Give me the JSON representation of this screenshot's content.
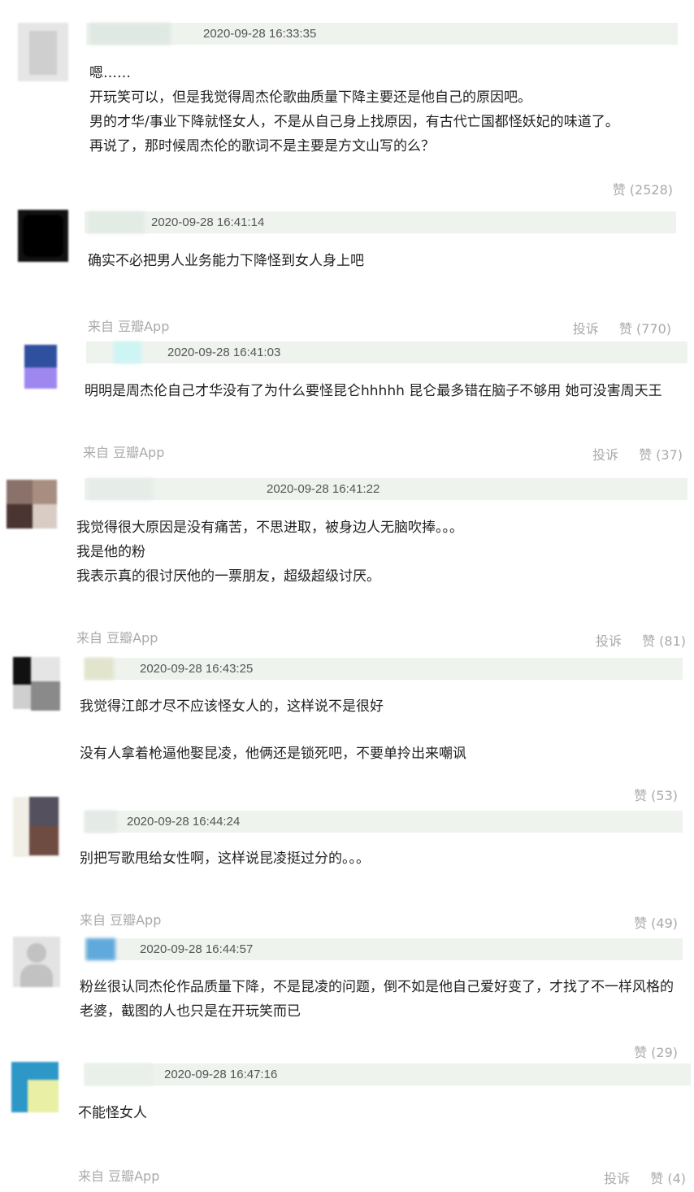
{
  "comments": [
    {
      "timestamp": "2020-09-28 16:33:35",
      "lines": [
        "嗯……",
        "开玩笑可以，但是我觉得周杰伦歌曲质量下降主要还是他自己的原因吧。",
        "男的才华/事业下降就怪女人，不是从自己身上找原因，有古代亡国都怪妖妃的味道了。",
        "再说了，那时候周杰伦的歌词不是主要是方文山写的么？"
      ],
      "source": "",
      "report": "",
      "like": "赞 (2528)"
    },
    {
      "timestamp": "2020-09-28 16:41:14",
      "lines": [
        "确实不必把男人业务能力下降怪到女人身上吧"
      ],
      "source": "来自 豆瓣App",
      "report": "投诉",
      "like": "赞 (770)"
    },
    {
      "timestamp": "2020-09-28 16:41:03",
      "lines": [
        "明明是周杰伦自己才华没有了为什么要怪昆仑hhhhh 昆仑最多错在脑子不够用 她可没害周天王"
      ],
      "source": "来自 豆瓣App",
      "report": "投诉",
      "like": "赞 (37)"
    },
    {
      "timestamp": "2020-09-28 16:41:22",
      "lines": [
        "我觉得很大原因是没有痛苦，不思进取，被身边人无脑吹捧。。。",
        "我是他的粉",
        "我表示真的很讨厌他的一票朋友，超级超级讨厌。"
      ],
      "source": "来自 豆瓣App",
      "report": "投诉",
      "like": "赞 (81)"
    },
    {
      "timestamp": "2020-09-28 16:43:25",
      "lines": [
        "我觉得江郎才尽不应该怪女人的，这样说不是很好",
        "",
        "没有人拿着枪逼他娶昆凌，他俩还是锁死吧，不要单拎出来嘲讽"
      ],
      "source": "",
      "report": "",
      "like": "赞 (53)"
    },
    {
      "timestamp": "2020-09-28 16:44:24",
      "lines": [
        "别把写歌甩给女性啊，这样说昆凌挺过分的。。。"
      ],
      "source": "来自 豆瓣App",
      "report": "",
      "like": "赞 (49)"
    },
    {
      "timestamp": "2020-09-28 16:44:57",
      "lines": [
        "粉丝很认同杰伦作品质量下降，不是昆凌的问题，倒不如是他自己爱好变了，才找了不一样风格的",
        "老婆，截图的人也只是在开玩笑而已"
      ],
      "source": "",
      "report": "",
      "like": "赞 (29)"
    },
    {
      "timestamp": "2020-09-28 16:47:16",
      "lines": [
        "不能怪女人"
      ],
      "source": "来自 豆瓣App",
      "report": "投诉",
      "like": "赞 (4)"
    }
  ]
}
